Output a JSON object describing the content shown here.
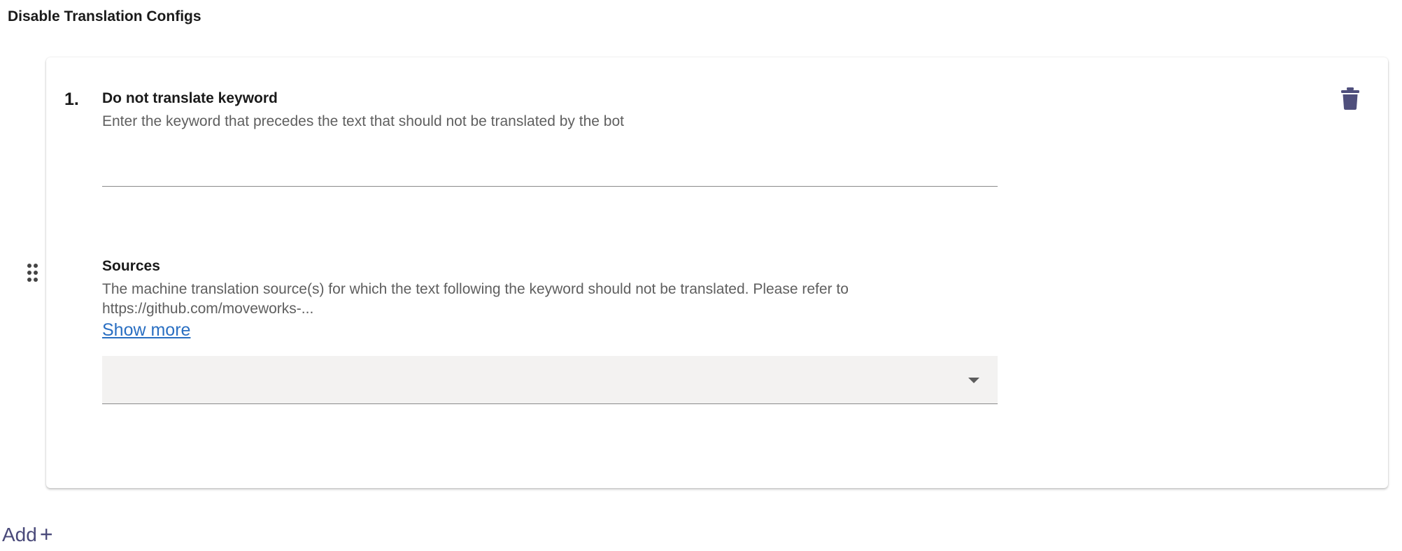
{
  "section": {
    "title": "Disable Translation Configs"
  },
  "items": [
    {
      "number": "1.",
      "keyword_field": {
        "label": "Do not translate keyword",
        "description": "Enter the keyword that precedes the text that should not be translated by the bot",
        "value": "",
        "placeholder": ""
      },
      "sources_field": {
        "label": "Sources",
        "description_line1": "The machine translation source(s) for which the text following the keyword should not be translated. Please refer to",
        "description_line2": "https://github.com/moveworks-...",
        "show_more_label": "Show more",
        "selected_value": ""
      }
    }
  ],
  "actions": {
    "add_label": "Add",
    "add_symbol": "+"
  },
  "icons": {
    "delete": "trash-icon",
    "drag": "drag-handle-icon",
    "dropdown": "chevron-down-icon"
  },
  "colors": {
    "delete_icon": "#4f4f7c",
    "link": "#2a6fc2",
    "add_button": "#4a4a7a",
    "select_background": "#f3f2f1"
  }
}
